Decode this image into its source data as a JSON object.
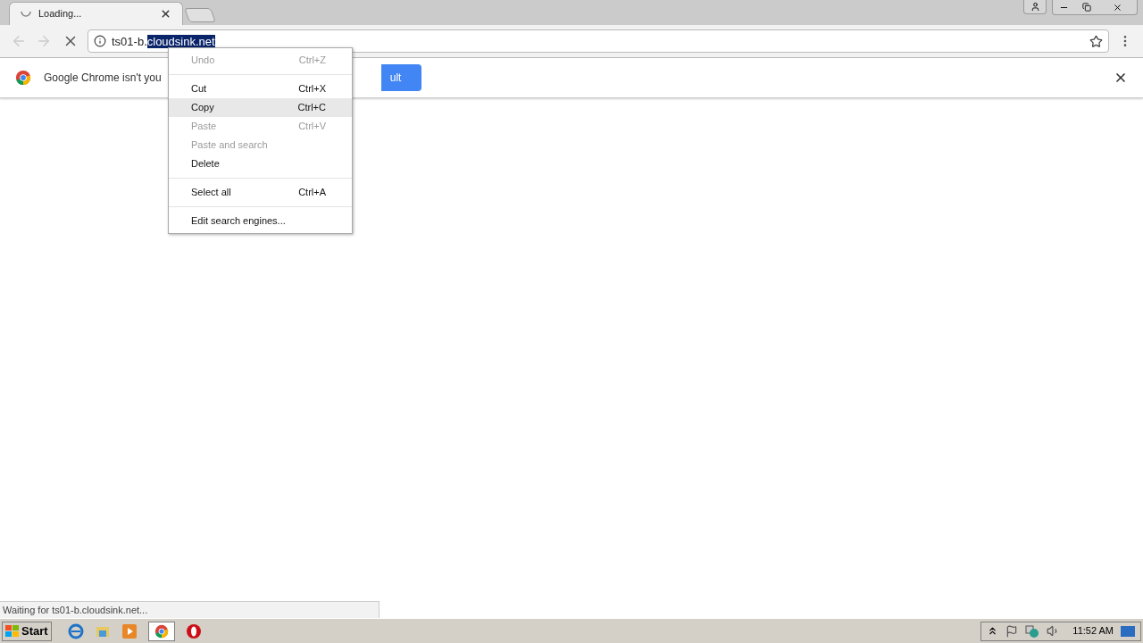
{
  "tabs": [
    {
      "title": "Loading...",
      "selected": true
    }
  ],
  "address": {
    "prefix": "ts01-b.",
    "selected_text": "cloudsink.net"
  },
  "infobar": {
    "message": "Google Chrome isn't you",
    "button": "ult"
  },
  "context_menu": [
    {
      "kind": "item",
      "label": "Undo",
      "shortcut": "Ctrl+Z",
      "disabled": true,
      "selected": false
    },
    {
      "kind": "separator"
    },
    {
      "kind": "item",
      "label": "Cut",
      "shortcut": "Ctrl+X",
      "disabled": false,
      "selected": false
    },
    {
      "kind": "item",
      "label": "Copy",
      "shortcut": "Ctrl+C",
      "disabled": false,
      "selected": true
    },
    {
      "kind": "item",
      "label": "Paste",
      "shortcut": "Ctrl+V",
      "disabled": true,
      "selected": false
    },
    {
      "kind": "item",
      "label": "Paste and search",
      "disabled": true,
      "selected": false
    },
    {
      "kind": "item",
      "label": "Delete",
      "disabled": false,
      "selected": false
    },
    {
      "kind": "separator"
    },
    {
      "kind": "item",
      "label": "Select all",
      "shortcut": "Ctrl+A",
      "disabled": false,
      "selected": false
    },
    {
      "kind": "separator"
    },
    {
      "kind": "item",
      "label": "Edit search engines...",
      "disabled": false,
      "selected": false
    }
  ],
  "status": "Waiting for ts01-b.cloudsink.net...",
  "taskbar": {
    "start": "Start",
    "clock": "11:52 AM"
  }
}
